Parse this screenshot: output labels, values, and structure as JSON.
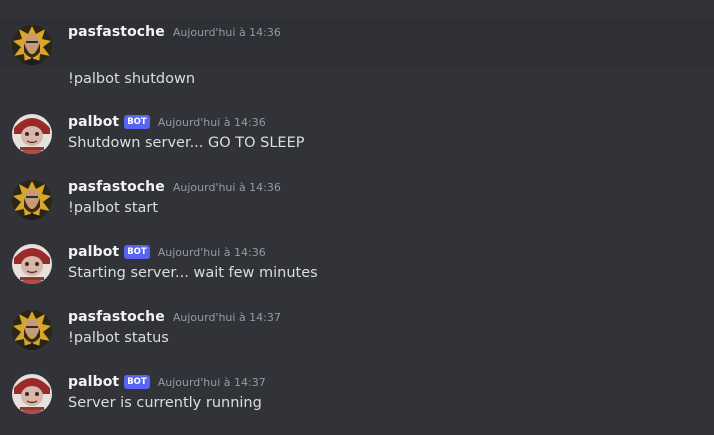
{
  "colors": {
    "background": "#313338",
    "hover_background": "#2e3035",
    "username": "#f2f3f5",
    "timestamp": "#949ba4",
    "message_text": "#dbdee1",
    "bot_tag": "#5865f2"
  },
  "messages": [
    {
      "avatar_icon": "bearded-man-avatar-icon",
      "username": "pasfastoche",
      "bot_tag": "",
      "timestamp": "Aujourd'hui à 14:36",
      "text": "!palbot shutdown"
    },
    {
      "avatar_icon": "bot-character-avatar-icon",
      "username": "palbot",
      "bot_tag": "BOT",
      "timestamp": "Aujourd'hui à 14:36",
      "text": "Shutdown server... GO TO SLEEP"
    },
    {
      "avatar_icon": "bearded-man-avatar-icon",
      "username": "pasfastoche",
      "bot_tag": "",
      "timestamp": "Aujourd'hui à 14:36",
      "text": "!palbot start"
    },
    {
      "avatar_icon": "bot-character-avatar-icon",
      "username": "palbot",
      "bot_tag": "BOT",
      "timestamp": "Aujourd'hui à 14:36",
      "text": "Starting server... wait few minutes"
    },
    {
      "avatar_icon": "bearded-man-avatar-icon",
      "username": "pasfastoche",
      "bot_tag": "",
      "timestamp": "Aujourd'hui à 14:37",
      "text": "!palbot status"
    },
    {
      "avatar_icon": "bot-character-avatar-icon",
      "username": "palbot",
      "bot_tag": "BOT",
      "timestamp": "Aujourd'hui à 14:37",
      "text": "Server is currently running"
    }
  ]
}
